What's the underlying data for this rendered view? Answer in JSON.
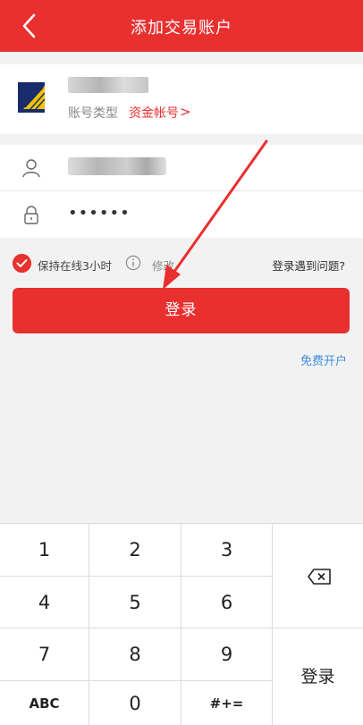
{
  "header": {
    "title": "添加交易账户",
    "back_icon": "chevron-left-icon"
  },
  "broker": {
    "account_type_label": "账号类型",
    "account_type_value": "资金帐号",
    "chevron": ">"
  },
  "form": {
    "password_mask": "••••••"
  },
  "options": {
    "keep_online": "保持在线3小时",
    "modify": "修改",
    "problem": "登录遇到问题?"
  },
  "login_button": "登录",
  "open_account_link": "免费开户",
  "keypad": {
    "keys": [
      "1",
      "2",
      "3",
      "4",
      "5",
      "6",
      "7",
      "8",
      "9",
      "ABC",
      "0",
      "#+="
    ],
    "submit": "登录",
    "backspace_icon": "backspace-icon"
  },
  "colors": {
    "brand": "#e8302f",
    "link": "#3d8fdc"
  }
}
